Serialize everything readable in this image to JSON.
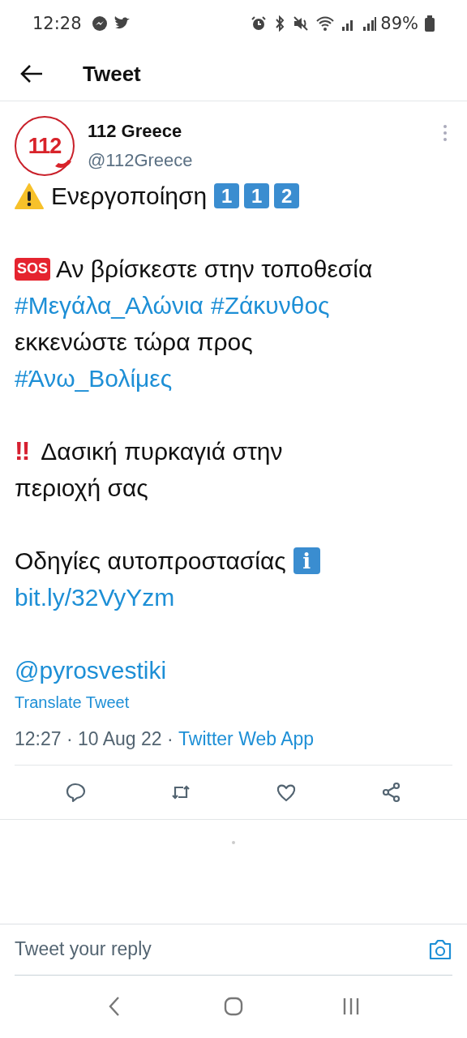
{
  "status_bar": {
    "time": "12:28",
    "battery": "89%"
  },
  "header": {
    "title": "Tweet"
  },
  "tweet": {
    "author": {
      "name": "112 Greece",
      "handle": "@112Greece",
      "logo_text": "112"
    },
    "paragraphs": [
      {
        "lines": [
          [
            {
              "kind": "warning"
            },
            {
              "kind": "text",
              "text": "Ενεργοποίηση"
            },
            {
              "kind": "keycap",
              "text": "1"
            },
            {
              "kind": "keycap",
              "text": "1"
            },
            {
              "kind": "keycap",
              "text": "2"
            }
          ]
        ]
      },
      {
        "lines": [
          [
            {
              "kind": "sos",
              "text": "SOS"
            },
            {
              "kind": "text",
              "text": "Αν βρίσκεστε στην τοποθεσία"
            }
          ],
          [
            {
              "kind": "hashtag",
              "text": "#Μεγάλα_Αλώνια"
            },
            {
              "kind": "hashtag",
              "text": "#Ζάκυνθος"
            }
          ],
          [
            {
              "kind": "text",
              "text": "εκκενώστε τώρα προς"
            }
          ],
          [
            {
              "kind": "hashtag",
              "text": "#Άνω_Βολίμες"
            }
          ]
        ]
      },
      {
        "lines": [
          [
            {
              "kind": "bangbang",
              "text": "‼"
            },
            {
              "kind": "text",
              "text": " Δασική πυρκαγιά στην"
            }
          ],
          [
            {
              "kind": "text",
              "text": "περιοχή σας"
            }
          ]
        ]
      },
      {
        "lines": [
          [
            {
              "kind": "text",
              "text": "Οδηγίες αυτοπροστασίας"
            },
            {
              "kind": "info",
              "text": "i"
            }
          ],
          [
            {
              "kind": "link",
              "text": "bit.ly/32VyYzm"
            }
          ]
        ]
      },
      {
        "lines": [
          [
            {
              "kind": "mention",
              "text": "@pyrosvestiki"
            }
          ]
        ]
      }
    ],
    "translate": "Translate Tweet",
    "timestamp": "12:27 · 10 Aug 22 · ",
    "source": "Twitter Web App"
  },
  "reply": {
    "placeholder": "Tweet your reply"
  }
}
